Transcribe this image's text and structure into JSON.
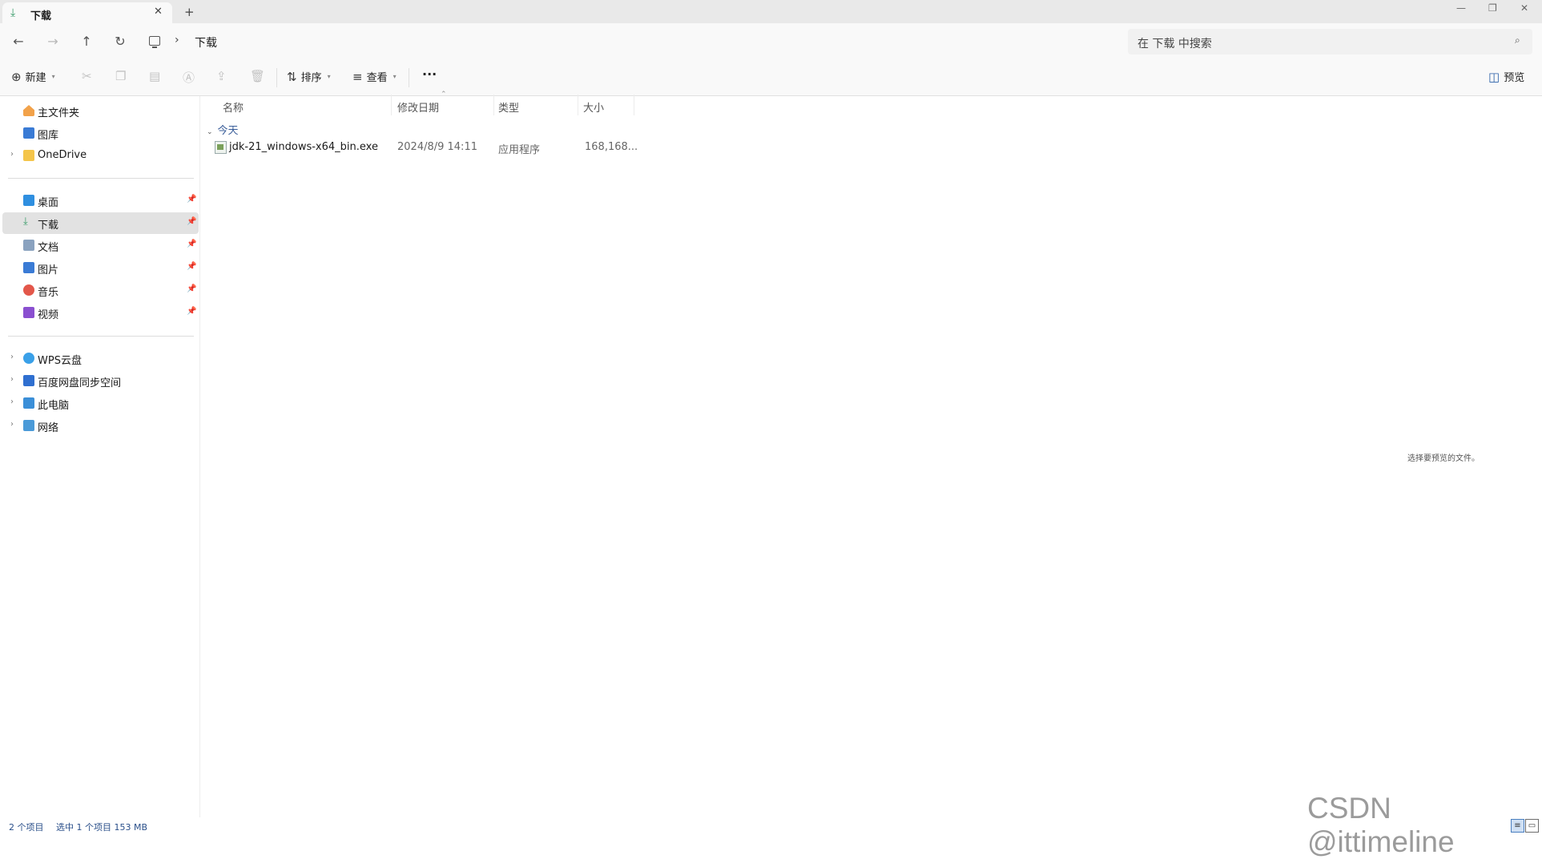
{
  "tab": {
    "title": "下载",
    "close": "✕",
    "new_tab": "+"
  },
  "window_controls": {
    "minimize": "—",
    "restore": "❐",
    "close": "✕"
  },
  "nav": {
    "back": "←",
    "forward": "→",
    "up": "↑",
    "refresh": "↻"
  },
  "address": {
    "separator": "›",
    "crumb": "下载"
  },
  "search": {
    "placeholder": "在 下载 中搜索",
    "icon": "⌕"
  },
  "commands": {
    "new_label": "新建",
    "sort_label": "排序",
    "view_label": "查看",
    "more": "···",
    "preview_label": "预览"
  },
  "sidebar": {
    "home": "主文件夹",
    "gallery": "图库",
    "onedrive": "OneDrive",
    "desktop": "桌面",
    "downloads": "下载",
    "documents": "文档",
    "pictures": "图片",
    "music": "音乐",
    "videos": "视频",
    "wps": "WPS云盘",
    "baidu": "百度网盘同步空间",
    "thispc": "此电脑",
    "network": "网络"
  },
  "columns": {
    "name": "名称",
    "date": "修改日期",
    "type": "类型",
    "size": "大小"
  },
  "group": {
    "label": "今天"
  },
  "files": [
    {
      "name": "jdk-21_windows-x64_bin.exe",
      "date": "2024/8/9 14:11",
      "type": "应用程序",
      "size": "168,168..."
    }
  ],
  "preview": {
    "message": "选择要预览的文件。"
  },
  "status": {
    "count": "2 个项目",
    "selection": "选中 1 个项目  153 MB"
  },
  "watermark": "CSDN @ittimeline",
  "colors": {
    "accent": "#3a9c6a",
    "selected_bg": "#e2e2e2",
    "status_text": "#2a4f8a"
  }
}
